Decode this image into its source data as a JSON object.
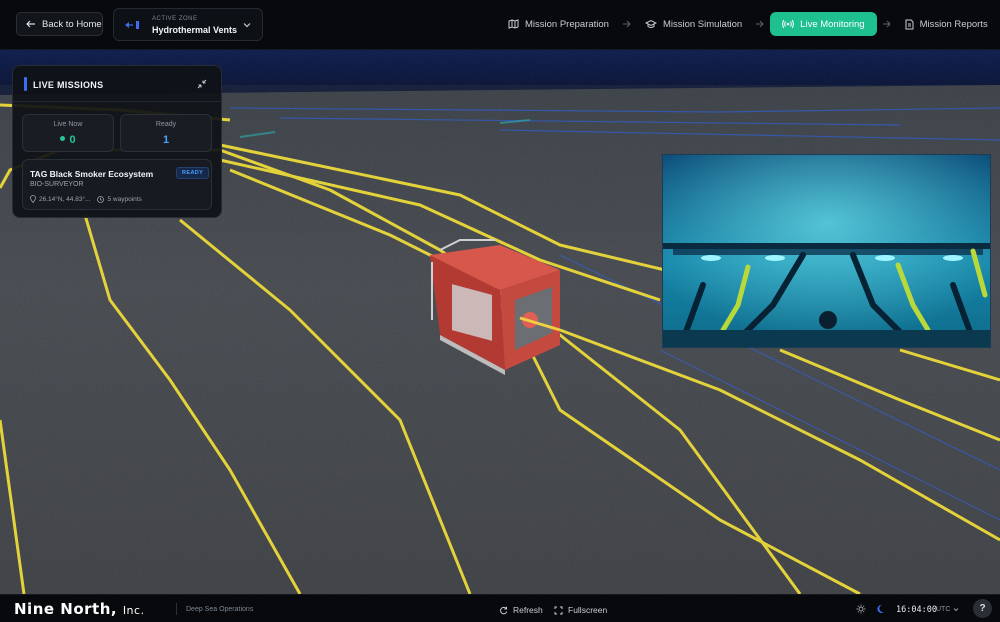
{
  "header": {
    "back_label": "Back to Home",
    "zone": {
      "label": "ACTIVE ZONE",
      "value": "Hydrothermal Vents"
    },
    "steps": [
      {
        "label": "Mission Preparation",
        "icon": "map-icon",
        "active": false
      },
      {
        "label": "Mission Simulation",
        "icon": "graduation-cap-icon",
        "active": false
      },
      {
        "label": "Live Monitoring",
        "icon": "broadcast-icon",
        "active": true
      },
      {
        "label": "Mission Reports",
        "icon": "document-icon",
        "active": false
      }
    ],
    "accent_color": "#1ec08f"
  },
  "live_missions": {
    "title": "LIVE MISSIONS",
    "stats": {
      "live_label": "Live Now",
      "live_value": "0",
      "ready_label": "Ready",
      "ready_value": "1"
    },
    "missions": [
      {
        "name": "TAG Black Smoker Ecosystem",
        "status": "READY",
        "type": "BIO-SURVEYOR",
        "location": "26.14°N, 44.83°...",
        "waypoints": "5 waypoints"
      }
    ]
  },
  "footer": {
    "brand": "Nine North,",
    "brand_suffix": "Inc.",
    "subtitle": "Deep Sea Operations",
    "refresh_label": "Refresh",
    "fullscreen_label": "Fullscreen",
    "time": "16:04:00",
    "timezone": "UTC",
    "help": "?"
  }
}
